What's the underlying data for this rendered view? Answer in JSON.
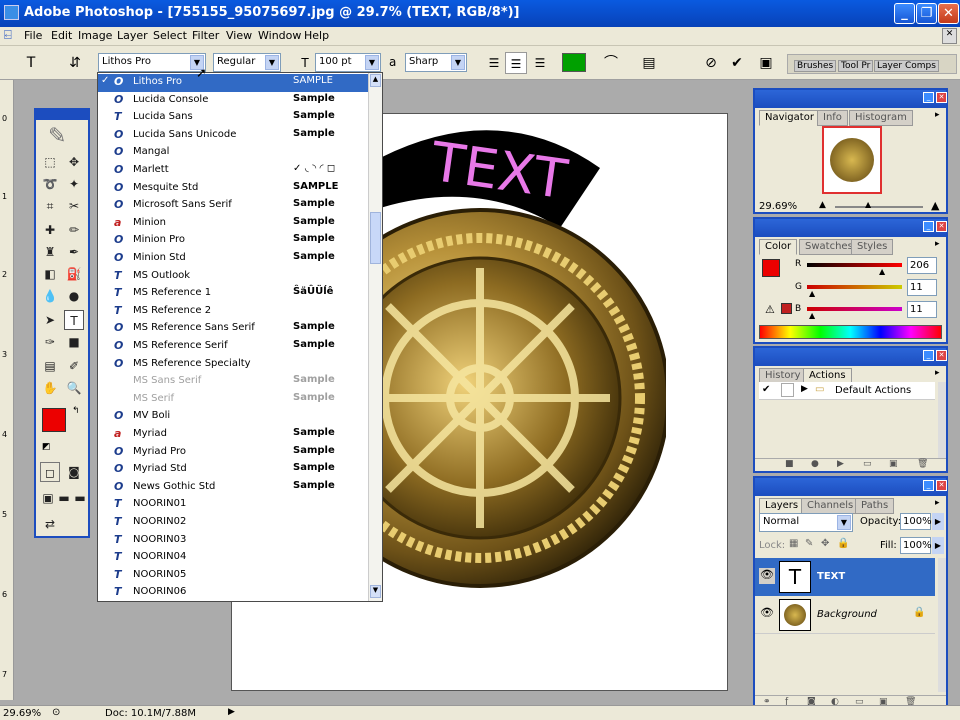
{
  "window": {
    "title": "Adobe Photoshop - [755155_95075697.jpg @ 29.7% (TEXT, RGB/8*)]"
  },
  "menu": [
    "File",
    "Edit",
    "Image",
    "Layer",
    "Select",
    "Filter",
    "View",
    "Window",
    "Help"
  ],
  "options": {
    "font_family": "Lithos Pro",
    "font_style": "Regular",
    "font_size": "100 pt",
    "aa_label": "a",
    "antialias": "Sharp",
    "color": "#00a000"
  },
  "panel_well": [
    "Brushes",
    "Tool Pr",
    "Layer Comps"
  ],
  "fontlist": [
    {
      "name": "Lithos Pro",
      "sample": "SAMPLE",
      "type": "O",
      "selected": true
    },
    {
      "name": "Lucida Console",
      "sample": "Sample",
      "type": "O"
    },
    {
      "name": "Lucida Sans",
      "sample": "Sample",
      "type": "T"
    },
    {
      "name": "Lucida Sans Unicode",
      "sample": "Sample",
      "type": "O"
    },
    {
      "name": "Mangal",
      "sample": "",
      "type": "O"
    },
    {
      "name": "Marlett",
      "sample": "✓ ◟ ◝ ◜ ◻",
      "type": "O"
    },
    {
      "name": "Mesquite Std",
      "sample": "SAMPLE",
      "type": "O"
    },
    {
      "name": "Microsoft Sans Serif",
      "sample": "Sample",
      "type": "O"
    },
    {
      "name": "Minion",
      "sample": "Sample",
      "type": "a"
    },
    {
      "name": "Minion Pro",
      "sample": "Sample",
      "type": "O"
    },
    {
      "name": "Minion Std",
      "sample": "Sample",
      "type": "O"
    },
    {
      "name": "MS Outlook",
      "sample": "",
      "type": "T"
    },
    {
      "name": "MS Reference 1",
      "sample": "ŜäÛÜĺê",
      "type": "T"
    },
    {
      "name": "MS Reference 2",
      "sample": "",
      "type": "T"
    },
    {
      "name": "MS Reference Sans Serif",
      "sample": "Sample",
      "type": "O"
    },
    {
      "name": "MS Reference Serif",
      "sample": "Sample",
      "type": "O"
    },
    {
      "name": "MS Reference Specialty",
      "sample": "",
      "type": "O"
    },
    {
      "name": "MS Sans Serif",
      "sample": "Sample",
      "type": "",
      "disabled": true
    },
    {
      "name": "MS Serif",
      "sample": "Sample",
      "type": "",
      "disabled": true
    },
    {
      "name": "MV Boli",
      "sample": "",
      "type": "O"
    },
    {
      "name": "Myriad",
      "sample": "Sample",
      "type": "a"
    },
    {
      "name": "Myriad Pro",
      "sample": "Sample",
      "type": "O"
    },
    {
      "name": "Myriad Std",
      "sample": "Sample",
      "type": "O"
    },
    {
      "name": "News Gothic Std",
      "sample": "Sample",
      "type": "O"
    },
    {
      "name": "NOORIN01",
      "sample": "",
      "type": "T"
    },
    {
      "name": "NOORIN02",
      "sample": "",
      "type": "T"
    },
    {
      "name": "NOORIN03",
      "sample": "",
      "type": "T"
    },
    {
      "name": "NOORIN04",
      "sample": "",
      "type": "T"
    },
    {
      "name": "NOORIN05",
      "sample": "",
      "type": "T"
    },
    {
      "name": "NOORIN06",
      "sample": "",
      "type": "T"
    }
  ],
  "canvas": {
    "text": "TEXT"
  },
  "navigator": {
    "tabs": [
      "Navigator",
      "Info",
      "Histogram"
    ],
    "zoom": "29.69%"
  },
  "color": {
    "tabs": [
      "Color",
      "Swatches",
      "Styles"
    ],
    "r_label": "R",
    "g_label": "G",
    "b_label": "B",
    "r": "206",
    "g": "11",
    "b": "11",
    "swatch": "#ce0b0b"
  },
  "history": {
    "tabs": [
      "History",
      "Actions"
    ],
    "item": "Default Actions"
  },
  "layers": {
    "tabs": [
      "Layers",
      "Channels",
      "Paths"
    ],
    "blend": "Normal",
    "opacity_label": "Opacity:",
    "opacity": "100%",
    "lock_label": "Lock:",
    "fill_label": "Fill:",
    "fill": "100%",
    "items": [
      "TEXT",
      "Background"
    ]
  },
  "status": {
    "zoom": "29.69%",
    "doc": "Doc: 10.1M/7.88M"
  }
}
